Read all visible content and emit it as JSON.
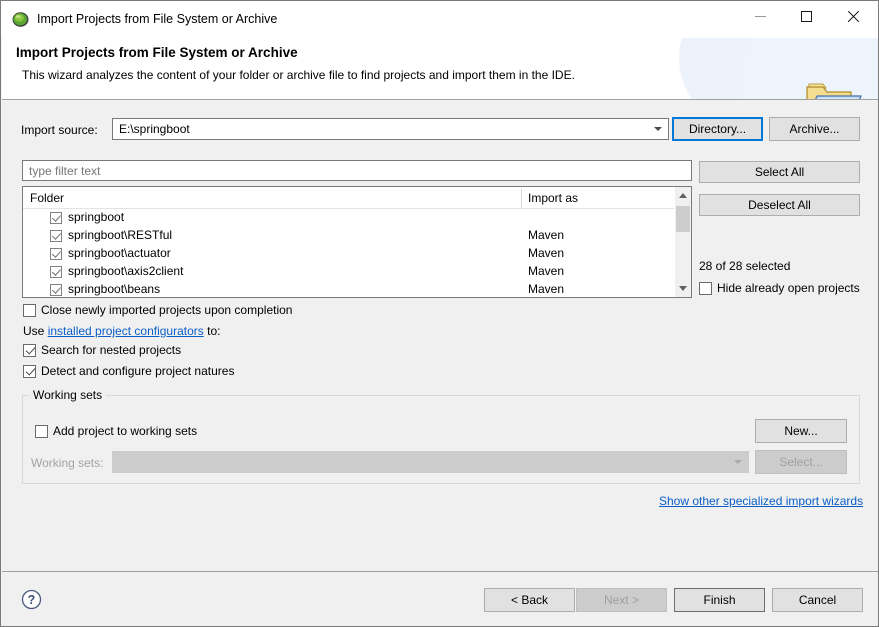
{
  "window": {
    "title": "Import Projects from File System or Archive",
    "app_icon": "eclipse-icon",
    "controls": {
      "minimize": "minimize-icon",
      "maximize": "maximize-icon",
      "close": "close-icon"
    }
  },
  "banner": {
    "title": "Import Projects from File System or Archive",
    "description": "This wizard analyzes the content of your folder or archive file to find projects and import them in the IDE.",
    "icon": "open-folder-icon"
  },
  "import_source": {
    "label": "Import source:",
    "value": "E:\\springboot",
    "directory_button": "Directory...",
    "archive_button": "Archive..."
  },
  "filter": {
    "placeholder": "type filter text",
    "value": ""
  },
  "tree": {
    "columns": [
      "Folder",
      "Import as"
    ],
    "rows": [
      {
        "folder": "springboot",
        "import_as": "",
        "checked": true
      },
      {
        "folder": "springboot\\RESTful",
        "import_as": "Maven",
        "checked": true
      },
      {
        "folder": "springboot\\actuator",
        "import_as": "Maven",
        "checked": true
      },
      {
        "folder": "springboot\\axis2client",
        "import_as": "Maven",
        "checked": true
      },
      {
        "folder": "springboot\\beans",
        "import_as": "Maven",
        "checked": true
      }
    ],
    "scrollbar": {
      "up_icon": "chevron-up-icon",
      "down_icon": "chevron-down-icon"
    }
  },
  "selection_panel": {
    "select_all": "Select All",
    "deselect_all": "Deselect All",
    "count_text": "28 of 28 selected",
    "hide_open_projects": {
      "label": "Hide already open projects",
      "checked": false
    }
  },
  "options": {
    "close_newly_imported": {
      "label": "Close newly imported projects upon completion",
      "checked": false
    },
    "configurators_prefix": "Use ",
    "configurators_link": "installed project configurators",
    "configurators_suffix": " to:",
    "search_nested": {
      "label": "Search for nested projects",
      "checked": true
    },
    "detect_natures": {
      "label": "Detect and configure project natures",
      "checked": true
    }
  },
  "working_sets": {
    "group_title": "Working sets",
    "add_to_working_sets": {
      "label": "Add project to working sets",
      "checked": false
    },
    "working_sets_label": "Working sets:",
    "working_sets_value": "",
    "new_button": "New...",
    "select_button": "Select..."
  },
  "other_wizards_link": "Show other specialized import wizards",
  "footer": {
    "help_icon": "help-icon",
    "back": "< Back",
    "next": "Next >",
    "finish": "Finish",
    "cancel": "Cancel"
  },
  "colors": {
    "accent": "#0078d7",
    "link": "#0b5ec7",
    "dialog_bg": "#f0f0f0",
    "field_bg": "#ffffff"
  }
}
